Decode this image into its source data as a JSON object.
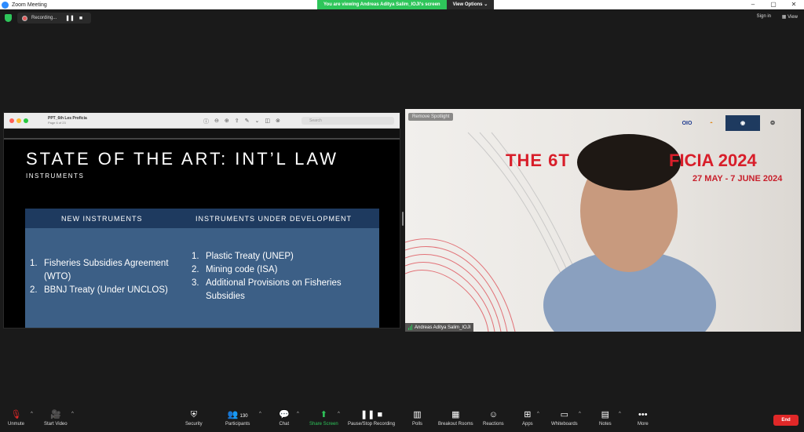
{
  "window": {
    "title": "Zoom Meeting",
    "minimize": "–",
    "maximize": "▢",
    "close": "✕"
  },
  "viewing_banner": {
    "message": "You are viewing Andreas Aditya Salim_IOJI's screen",
    "options_label": "View Options",
    "options_caret": "⌄"
  },
  "recording": {
    "label": "Recording...",
    "pause": "❚❚",
    "stop": "■"
  },
  "top_right": {
    "sign_in": "Sign in",
    "view": "View",
    "view_icon": "▦"
  },
  "preview": {
    "file_name": "PPT_6th Les Proficia",
    "page_info": "Page 6 of 23",
    "search_placeholder": "Search",
    "toolbar_icons": [
      "ⓘ",
      "⊖",
      "⊕",
      "⇪",
      "✎",
      "⌄",
      "◫",
      "⊗"
    ]
  },
  "slide": {
    "title": "STATE OF THE ART: INT’L LAW",
    "subtitle": "INSTRUMENTS",
    "col1_header": "NEW INSTRUMENTS",
    "col2_header": "INSTRUMENTS UNDER DEVELOPMENT",
    "col1_items": [
      {
        "num": "1.",
        "text": "Fisheries Subsidies Agreement (WTO)"
      },
      {
        "num": "2.",
        "text": "BBNJ Treaty (Under UNCLOS)"
      }
    ],
    "col2_items": [
      {
        "num": "1.",
        "text": "Plastic Treaty (UNEP)"
      },
      {
        "num": "2.",
        "text": "Mining code (ISA)"
      },
      {
        "num": "3.",
        "text": "Additional Provisions on Fisheries Subsidies"
      }
    ]
  },
  "video": {
    "spotlight_label": "Remove Spotlight",
    "participant_name": "Andreas Aditya Salim_IOJI",
    "banner_left": "THE 6T",
    "banner_right": "FICIA 2024",
    "dates": "27 MAY - 7 JUNE 2024",
    "logo_text": "OIO"
  },
  "toolbar": {
    "unmute": "Unmute",
    "start_video": "Start Video",
    "security": "Security",
    "participants": "Participants",
    "participants_count": "130",
    "chat": "Chat",
    "share_screen": "Share Screen",
    "pause_recording": "Pause/Stop Recording",
    "polls": "Polls",
    "breakout_rooms": "Breakout Rooms",
    "reactions": "Reactions",
    "apps": "Apps",
    "whiteboards": "Whiteboards",
    "notes": "Notes",
    "more": "More",
    "end": "End",
    "caret": "^"
  },
  "colors": {
    "zoom_blue": "#2d8cff",
    "share_green": "#2ec55a",
    "end_red": "#e02828",
    "slide_table": "#3c5f86",
    "slide_header": "#1e3a5f",
    "banner_red": "#d81e2a"
  }
}
